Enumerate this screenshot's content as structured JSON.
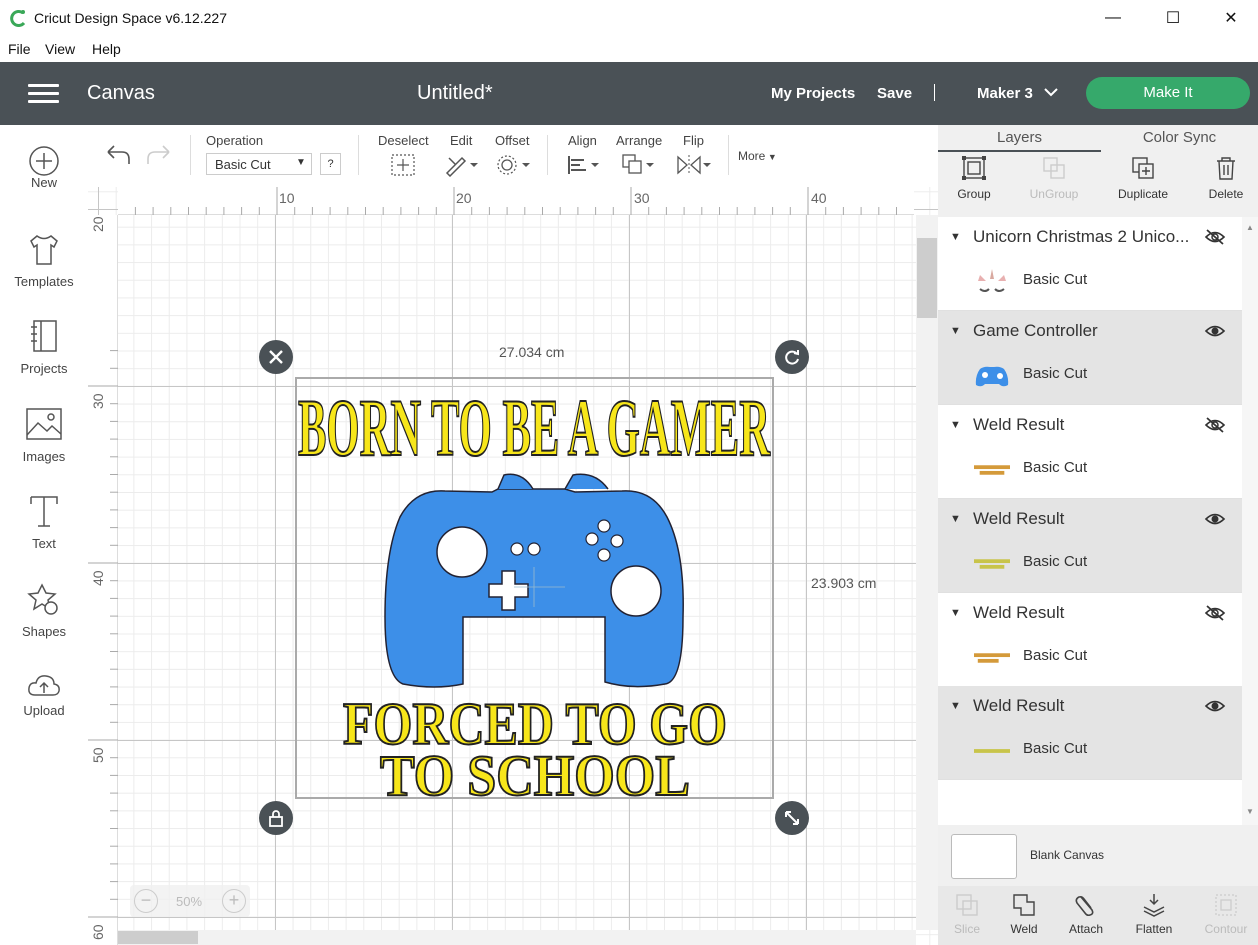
{
  "app": {
    "title": "Cricut Design Space  v6.12.227"
  },
  "window_controls": {
    "minimize": "—",
    "maximize": "☐",
    "close": "✕"
  },
  "menu": [
    "File",
    "View",
    "Help"
  ],
  "header": {
    "section": "Canvas",
    "document": "Untitled*",
    "my_projects": "My Projects",
    "save": "Save",
    "machine": "Maker 3",
    "make_it": "Make It",
    "accent_color": "#36a96b",
    "bar_color": "#4a5156"
  },
  "sidebar": [
    {
      "label": "New",
      "icon": "plus-circle-icon"
    },
    {
      "label": "Templates",
      "icon": "tshirt-icon"
    },
    {
      "label": "Projects",
      "icon": "notebook-icon"
    },
    {
      "label": "Images",
      "icon": "image-icon"
    },
    {
      "label": "Text",
      "icon": "text-t-icon"
    },
    {
      "label": "Shapes",
      "icon": "shapes-icon"
    },
    {
      "label": "Upload",
      "icon": "cloud-upload-icon"
    }
  ],
  "toolbar": {
    "operation_label": "Operation",
    "operation_value": "Basic Cut",
    "help": "?",
    "deselect": "Deselect",
    "edit": "Edit",
    "offset": "Offset",
    "align": "Align",
    "arrange": "Arrange",
    "flip": "Flip",
    "more": "More"
  },
  "canvas": {
    "ruler_top": [
      "10",
      "20",
      "30",
      "40"
    ],
    "ruler_left": [
      "20",
      "30",
      "40",
      "50",
      "60"
    ],
    "width_label": "27.034 cm",
    "height_label": "23.903 cm",
    "zoom": "50%",
    "design": {
      "line1": "BORN TO BE A GAMER",
      "line2": "FORCED TO GO",
      "line3": "TO  SCHOOL",
      "text_color": "#f7e61a",
      "controller_color": "#3d8fe8"
    }
  },
  "right_panel": {
    "tabs": [
      "Layers",
      "Color Sync"
    ],
    "actions": [
      {
        "label": "Group",
        "enabled": true
      },
      {
        "label": "UnGroup",
        "enabled": false
      },
      {
        "label": "Duplicate",
        "enabled": true
      },
      {
        "label": "Delete",
        "enabled": true
      }
    ],
    "layers": [
      {
        "name": "Unicorn Christmas 2 Unico...",
        "op": "Basic Cut",
        "visible": false,
        "thumb": "unicorn"
      },
      {
        "name": "Game Controller",
        "op": "Basic Cut",
        "visible": true,
        "thumb": "controller"
      },
      {
        "name": "Weld Result",
        "op": "Basic Cut",
        "visible": false,
        "thumb": "text-orange"
      },
      {
        "name": "Weld Result",
        "op": "Basic Cut",
        "visible": true,
        "thumb": "text-yellow"
      },
      {
        "name": "Weld Result",
        "op": "Basic Cut",
        "visible": false,
        "thumb": "text-orange"
      },
      {
        "name": "Weld Result",
        "op": "Basic Cut",
        "visible": true,
        "thumb": "text-yellow"
      }
    ],
    "blank_canvas": "Blank Canvas",
    "bottom_actions": [
      {
        "label": "Slice",
        "enabled": false
      },
      {
        "label": "Weld",
        "enabled": true
      },
      {
        "label": "Attach",
        "enabled": true
      },
      {
        "label": "Flatten",
        "enabled": true
      },
      {
        "label": "Contour",
        "enabled": false
      }
    ]
  }
}
